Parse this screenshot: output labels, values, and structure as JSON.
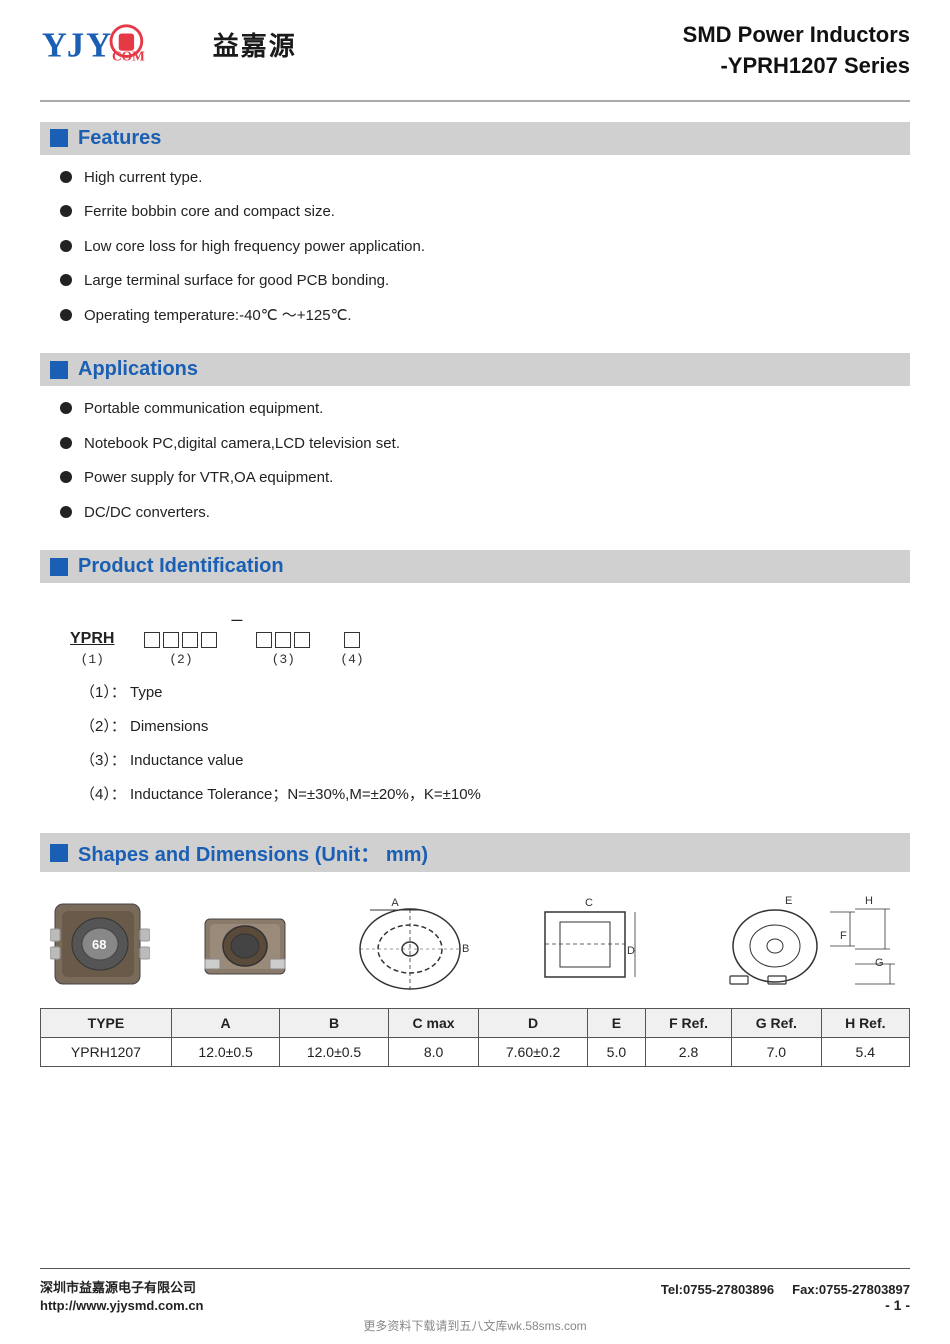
{
  "header": {
    "logo_cn": "益嘉源",
    "product_title_line1": "SMD Power Inductors",
    "product_title_line2": "-YPRH1207 Series"
  },
  "sections": {
    "features": {
      "title": "Features",
      "items": [
        "High current type.",
        "Ferrite bobbin core and compact size.",
        "Low core loss for high frequency power application.",
        "Large terminal surface for good PCB bonding.",
        "Operating temperature:-40℃ ～+125℃."
      ]
    },
    "applications": {
      "title": "Applications",
      "items": [
        "Portable communication equipment.",
        "Notebook PC,digital camera,LCD television set.",
        "Power supply for VTR,OA equipment.",
        "DC/DC converters."
      ]
    },
    "product_identification": {
      "title": "Product Identification",
      "diagram": {
        "prefix": "YPRH",
        "label1": "(1)",
        "boxes2": 4,
        "label2": "(2)",
        "dash": "—",
        "boxes3": 3,
        "label3": "(3)",
        "boxes4": 1,
        "label4": "(4)"
      },
      "notes": [
        "（1）： Type",
        "（2）： Dimensions",
        "（3）： Inductance value",
        "（4）： Inductance Tolerance；N=±30%,M=±20%，K=±10%"
      ]
    },
    "shapes_dimensions": {
      "title": "Shapes and Dimensions (Unit：  mm)",
      "table_headers": [
        "TYPE",
        "A",
        "B",
        "C max",
        "D",
        "E",
        "F Ref.",
        "G Ref.",
        "H Ref."
      ],
      "table_rows": [
        [
          "YPRH1207",
          "12.0±0.5",
          "12.0±0.5",
          "8.0",
          "7.60±0.2",
          "5.0",
          "2.8",
          "7.0",
          "5.4"
        ]
      ],
      "dimension_labels": [
        "A",
        "B",
        "C",
        "D",
        "E",
        "F",
        "G",
        "H"
      ]
    }
  },
  "footer": {
    "company_cn": "深圳市益嘉源电子有限公司",
    "website": "http://www.yjysmd.com.cn",
    "tel": "Tel:0755-27803896",
    "fax": "Fax:0755-27803897",
    "page": "- 1 -",
    "watermark": "更多资料下载请到五八文库wk.58sms.com"
  }
}
